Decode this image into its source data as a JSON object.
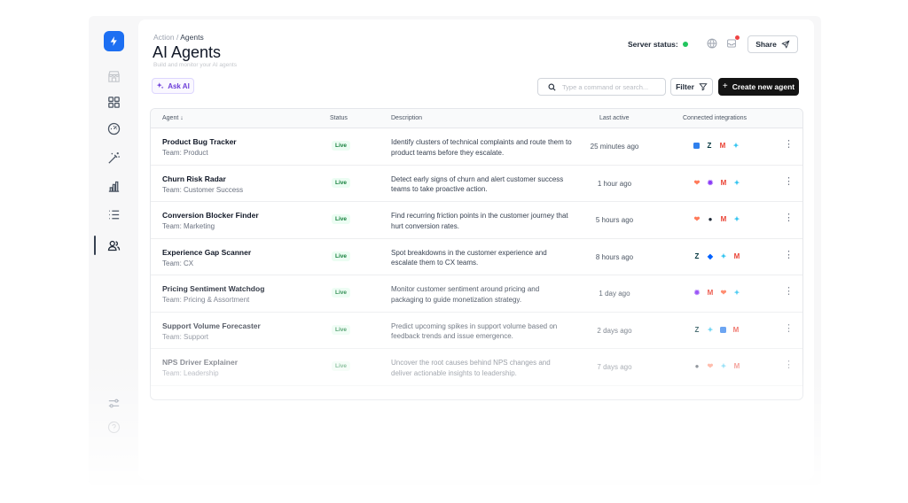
{
  "breadcrumb": {
    "parent": "Action",
    "separator": " / ",
    "current": "Agents"
  },
  "page": {
    "title": "AI Agents",
    "subtitle": "Build and monitor your AI agents"
  },
  "header": {
    "server_label": "Server status:",
    "server_status_color": "#22c55e",
    "share_label": "Share"
  },
  "toolbar": {
    "ask_ai_label": "Ask AI",
    "search_placeholder": "Type a command or search...",
    "filter_label": "Filter",
    "create_label": "Create new agent"
  },
  "sidebar": {
    "items": [
      {
        "icon": "storefront-icon"
      },
      {
        "icon": "grid-icon"
      },
      {
        "icon": "gauge-icon"
      },
      {
        "icon": "magic-wand-icon"
      },
      {
        "icon": "bar-chart-icon"
      },
      {
        "icon": "list-icon"
      },
      {
        "icon": "users-icon",
        "active": true
      },
      {
        "icon": "sliders-icon"
      },
      {
        "icon": "help-icon"
      }
    ]
  },
  "table": {
    "columns": {
      "agent": "Agent",
      "status": "Status",
      "description": "Description",
      "last_active": "Last active",
      "integrations": "Connected integrations"
    },
    "rows": [
      {
        "name": "Product Bug Tracker",
        "team": "Team: Product",
        "status": "Live",
        "desc": "Identify clusters of technical complaints and route them to product teams before they escalate.",
        "last": "25 minutes ago",
        "integrations": [
          "intercom",
          "zendesk",
          "gmail",
          "slack"
        ]
      },
      {
        "name": "Churn Risk Radar",
        "team": "Team: Customer Success",
        "status": "Live",
        "desc": "Detect early signs of churn and alert customer success teams to take proactive action.",
        "last": "1 hour ago",
        "integrations": [
          "hubspot",
          "gong",
          "gmail",
          "slack"
        ]
      },
      {
        "name": "Conversion Blocker Finder",
        "team": "Team: Marketing",
        "status": "Live",
        "desc": "Find recurring friction points in the customer journey that hurt conversion rates.",
        "last": "5 hours ago",
        "integrations": [
          "hubspot",
          "chat",
          "gmail",
          "slack"
        ]
      },
      {
        "name": "Experience Gap Scanner",
        "team": "Team: CX",
        "status": "Live",
        "desc": "Spot breakdowns in the customer experience and escalate them to CX teams.",
        "last": "8 hours ago",
        "integrations": [
          "zendesk",
          "dropbox",
          "slack",
          "gmail"
        ]
      },
      {
        "name": "Pricing Sentiment Watchdog",
        "team": "Team: Pricing & Assortment",
        "status": "Live",
        "desc": "Monitor customer sentiment around pricing and packaging to guide monetization strategy.",
        "last": "1 day ago",
        "integrations": [
          "gong",
          "gmail",
          "hubspot",
          "slack"
        ]
      },
      {
        "name": "Support Volume Forecaster",
        "team": "Team: Support",
        "status": "Live",
        "desc": "Predict upcoming spikes in support volume based on feedback trends and issue emergence.",
        "last": "2 days ago",
        "integrations": [
          "zendesk",
          "slack",
          "intercom",
          "gmail"
        ]
      },
      {
        "name": "NPS Driver Explainer",
        "team": "Team: Leadership",
        "status": "Live",
        "desc": "Uncover the root causes behind NPS changes and deliver actionable insights to leadership.",
        "last": "7 days ago",
        "integrations": [
          "chat",
          "hubspot",
          "slack",
          "gmail"
        ]
      }
    ]
  },
  "colors": {
    "accent": "#1d6ff2",
    "live_bg": "#ecfdf3",
    "live_text": "#16803d",
    "ask_ai": "#6d3ed8"
  }
}
